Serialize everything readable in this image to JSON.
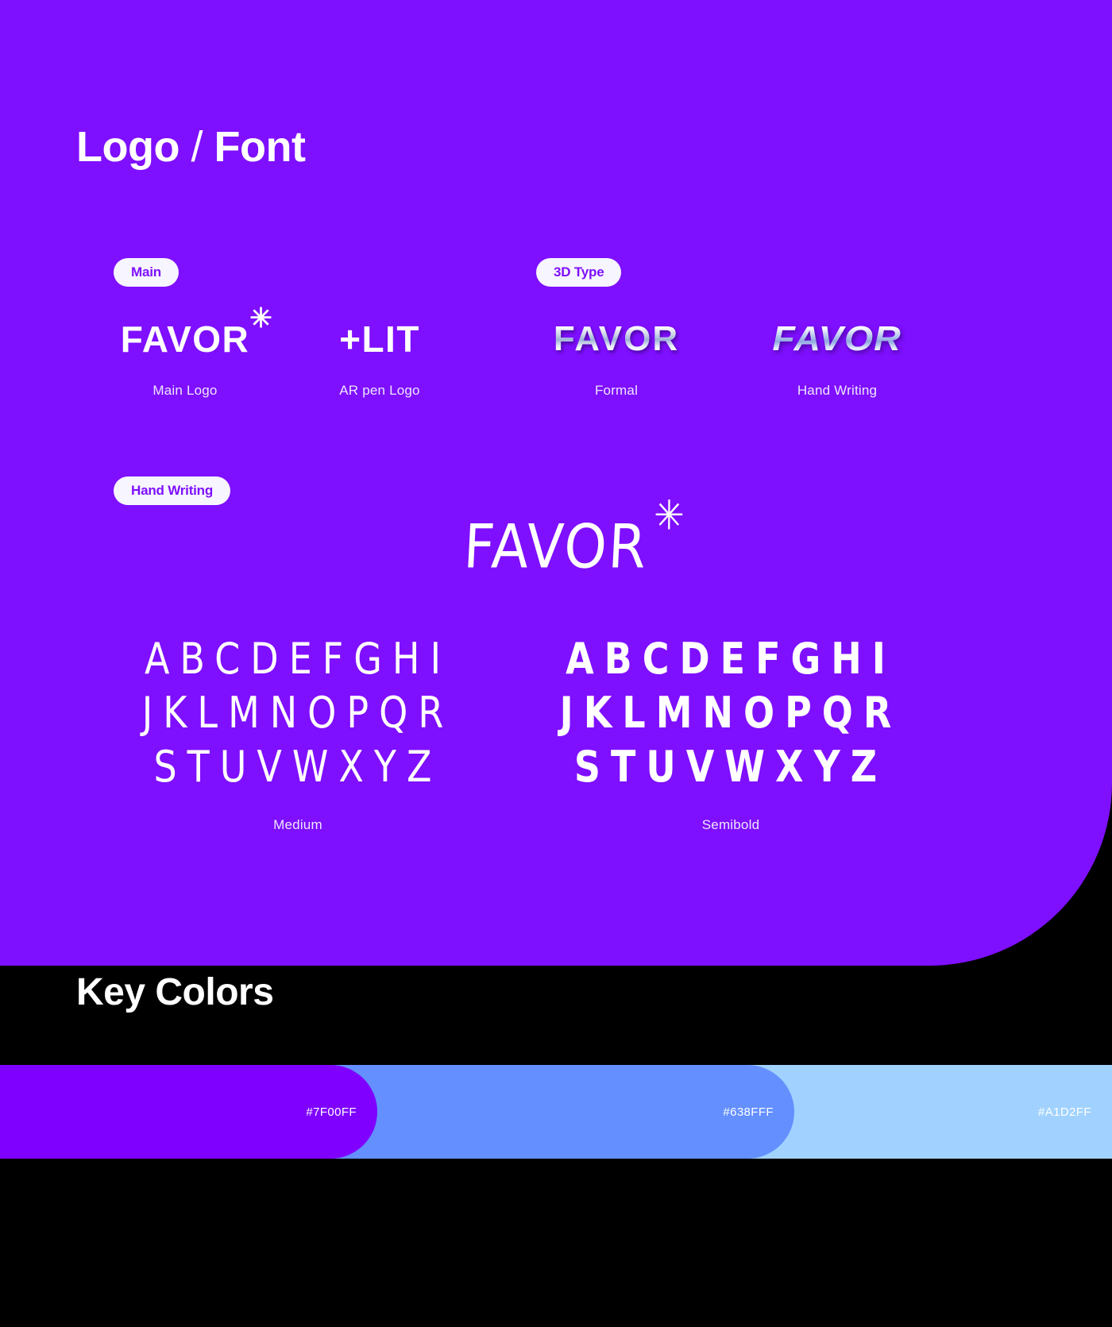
{
  "page": {
    "background": "#000000",
    "hero_background": "#7F0FFF"
  },
  "sections": {
    "logo_font": {
      "title_main": "Logo",
      "title_slash": "/",
      "title_sub": "Font"
    },
    "key_colors": {
      "title": "Key Colors"
    }
  },
  "badges": {
    "main": "Main",
    "three_d_type": "3D Type",
    "hand_writing": "Hand Writing"
  },
  "logos": [
    {
      "wordmark": "FAVOR",
      "star": "✳",
      "caption": "Main Logo"
    },
    {
      "wordmark": "+LIT",
      "star": "",
      "caption": "AR pen Logo"
    },
    {
      "wordmark": "FAVOR",
      "star": "✳",
      "caption": "Formal"
    },
    {
      "wordmark": "FAVOR",
      "star": "",
      "caption": "Hand Writing"
    }
  ],
  "hand_logo": {
    "wordmark": "FAVOR",
    "star": "✳"
  },
  "alphabet": {
    "rows": [
      "ABCDEFGHI",
      "JKLMNOPQR",
      "STUVWXYZ"
    ],
    "weights": {
      "medium": "Medium",
      "semibold": "Semibold"
    }
  },
  "swatches": [
    {
      "hex": "#7F00FF",
      "label": "#7F00FF"
    },
    {
      "hex": "#638FFF",
      "label": "#638FFF"
    },
    {
      "hex": "#A1D2FF",
      "label": "#A1D2FF"
    }
  ]
}
